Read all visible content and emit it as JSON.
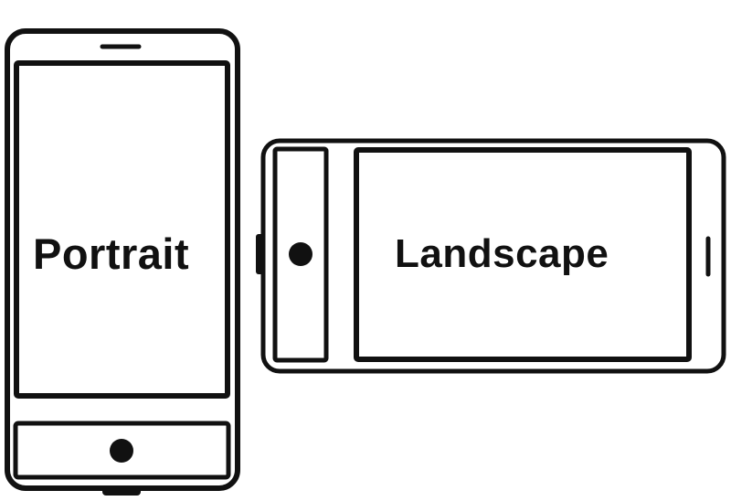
{
  "portrait_phone": {
    "label": "Portrait"
  },
  "landscape_phone": {
    "label": "Landscape"
  },
  "colors": {
    "outline": "#111111",
    "background": "#ffffff"
  }
}
